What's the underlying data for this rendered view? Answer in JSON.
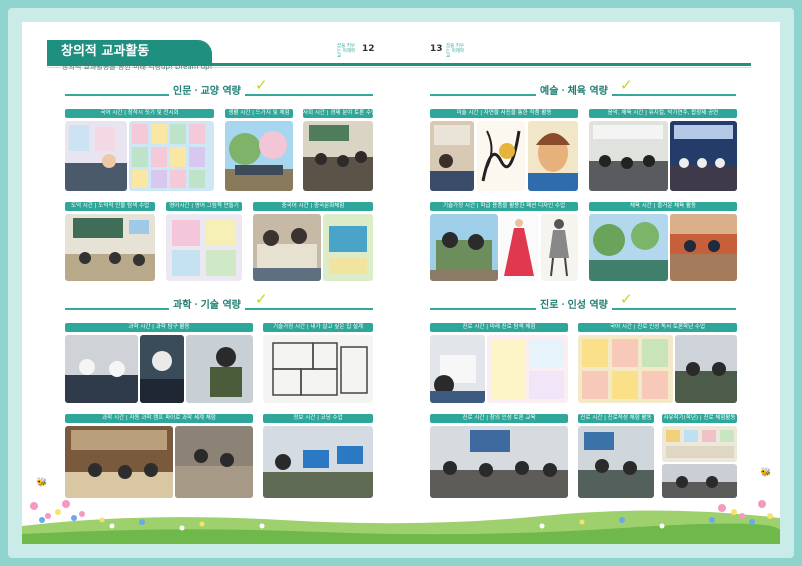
{
  "header": {
    "title": "창의적 교과활동",
    "subtitle": "창의적 교과활동을 통한 미래 역량up! Dream up!",
    "page_left": "12",
    "page_right": "13",
    "school_left": "꿈을 키우는 미래학교",
    "school_right": "꿈을 키우는 미래학교"
  },
  "sections": {
    "humanities": "인문ㆍ교양 역량",
    "arts": "예술ㆍ체육 역량",
    "science": "과학ㆍ기술 역량",
    "career": "진로ㆍ인성 역량"
  },
  "bars": {
    "korean": "국어 시간 | 창작시 짓기 및 전시회",
    "life": "생활 시간 | 드가지 및 체험",
    "society": "사회 시간 | 경제 분야 토론 수업",
    "ethics": "도덕 시간 | 도덕적 인물 탐색 수업",
    "english": "영어시간 | 영어 그림책 만들기",
    "chinese": "중국어 시간 | 중국문화체험",
    "art": "미술 시간 | 자연물 사진을 통한 작품 활동",
    "music_pe": "음악, 체육 시간 | 뮤지컬, 악기연주, 합창제 공연",
    "tech_home": "기술가정 시간 | 학급 용품을 활용한 패션 디자인 수업",
    "pe": "체육 시간 | 즐거운 체육 활동",
    "science": "과학 시간 | 과학 탐구 활동",
    "tech": "기술가정 시간 | 내가 살고 싶은 집 설계",
    "physics": "과학 시간 | 자동 과학 캠프 파이로 과학 세계 체험",
    "info": "정보 시간 | 코딩 수업",
    "career": "진로 시간 | 미래 진로 탐색 체험",
    "korean2": "국어 시간 | 진로 인성 독서 토론학년 수업",
    "career2": "진로 시간 | 창의 인성 토론 교육",
    "career3": "진로 시간 | 진로적성 체험 활동",
    "free": "자유학기(학년) | 진로 체험활동"
  },
  "colors": {
    "accent": "#1f8f80",
    "bar": "#2ea79a",
    "frame": "#8fd3cf"
  }
}
